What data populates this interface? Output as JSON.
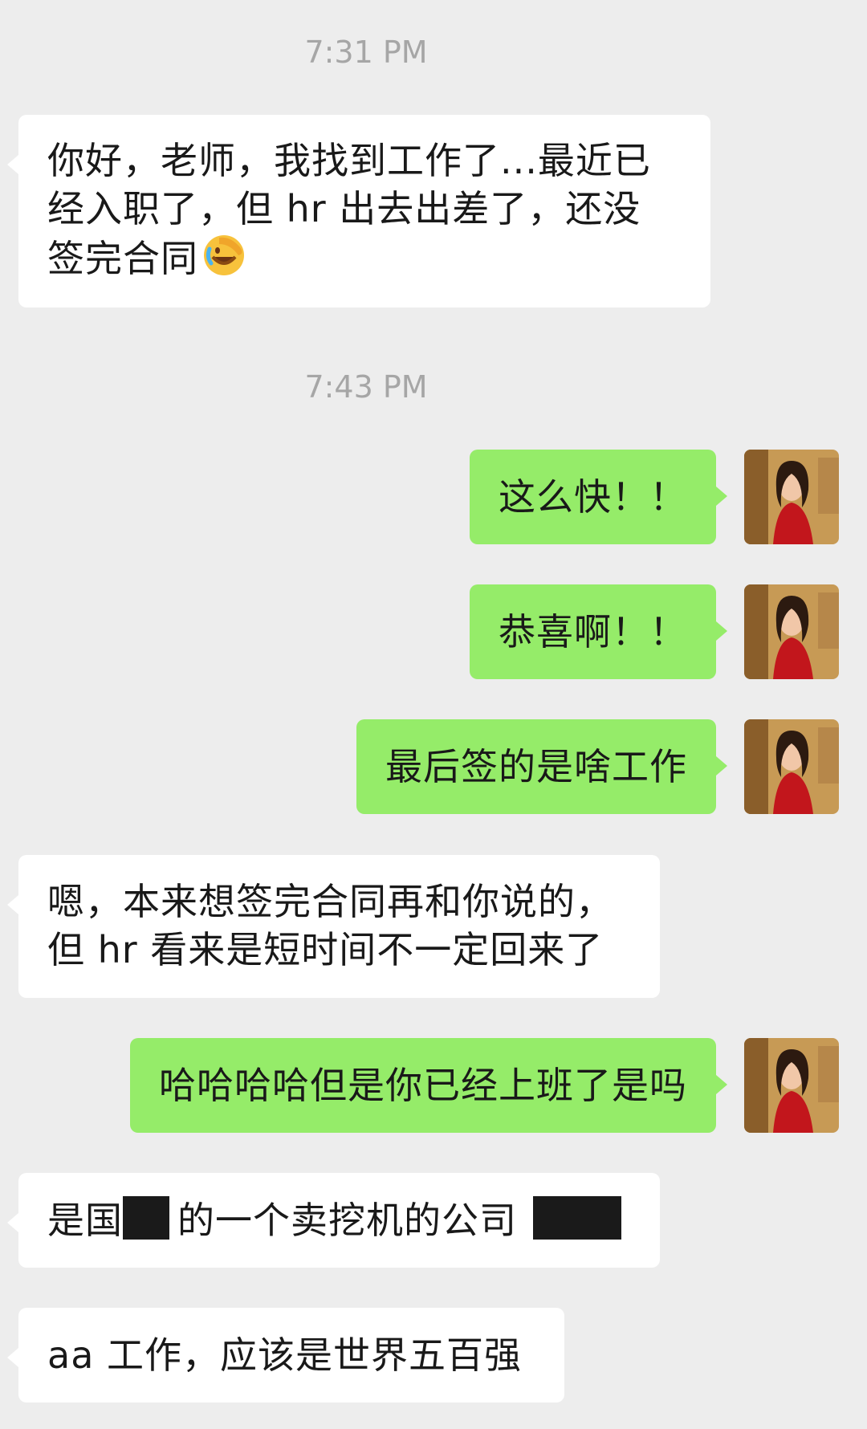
{
  "timestamps": [
    "7:31 PM",
    "7:43 PM"
  ],
  "messages": {
    "m1": {
      "line1": "你好，老师，我找到工作了...最近已",
      "line2": "经入职了，但 hr 出去出差了，还没",
      "line3": "签完合同"
    },
    "m2": "这么快！！",
    "m3": "恭喜啊！！",
    "m4": "最后签的是啥工作",
    "m5": {
      "line1": "嗯，本来想签完合同再和你说的，",
      "line2": "但 hr 看来是短时间不一定回来了"
    },
    "m6": "哈哈哈哈但是你已经上班了是吗",
    "m7": {
      "a": "是国",
      "b": "的一个卖挖机的公司"
    },
    "m8": "aa 工作，应该是世界五百强"
  },
  "icons": {
    "avatar": "profile-photo",
    "emoji": "facepalm-crying-emoji"
  },
  "colors": {
    "background": "#ededed",
    "incoming_bubble": "#ffffff",
    "outgoing_bubble": "#95ec69",
    "timestamp": "#a6a6a6"
  }
}
